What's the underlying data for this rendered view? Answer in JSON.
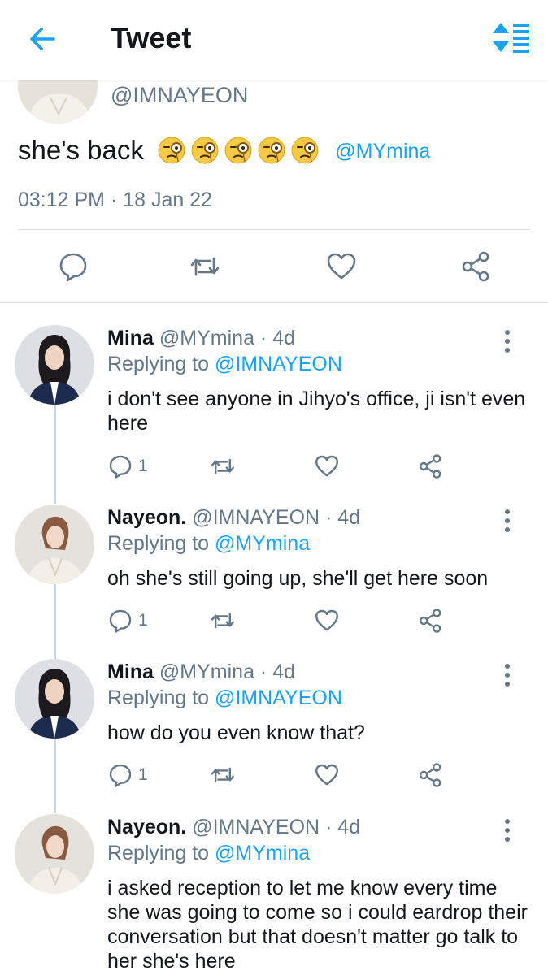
{
  "header": {
    "title": "Tweet"
  },
  "tweet": {
    "handle": "@IMNAYEON",
    "text": "she's back",
    "emoji_count": 5,
    "mention": "@MYmina",
    "timestamp": "03:12 PM · 18 Jan 22"
  },
  "colors": {
    "accent": "#1da1f2",
    "secondary_text": "#657786",
    "primary_text": "#14171a",
    "divider": "#d8dde1"
  },
  "replies": [
    {
      "name": "Mina",
      "meta": "@MYmina · 4d",
      "replying_label": "Replying to",
      "replying_to": "@IMNAYEON",
      "text": "i don't see anyone in Jihyo's office, ji isn't even here",
      "reply_count": "1"
    },
    {
      "name": "Nayeon.",
      "meta": "@IMNAYEON · 4d",
      "replying_label": "Replying to",
      "replying_to": "@MYmina",
      "text": "oh she's still going up, she'll get here soon",
      "reply_count": "1"
    },
    {
      "name": "Mina",
      "meta": "@MYmina · 4d",
      "replying_label": "Replying to",
      "replying_to": "@IMNAYEON",
      "text": "how do you even know that?",
      "reply_count": "1"
    },
    {
      "name": "Nayeon.",
      "meta": "@IMNAYEON · 4d",
      "replying_label": "Replying to",
      "replying_to": "@MYmina",
      "text": "i asked reception to let me know every time she was going to come so i could eardrop their conversation but that doesn't matter go talk to her she's here"
    }
  ]
}
